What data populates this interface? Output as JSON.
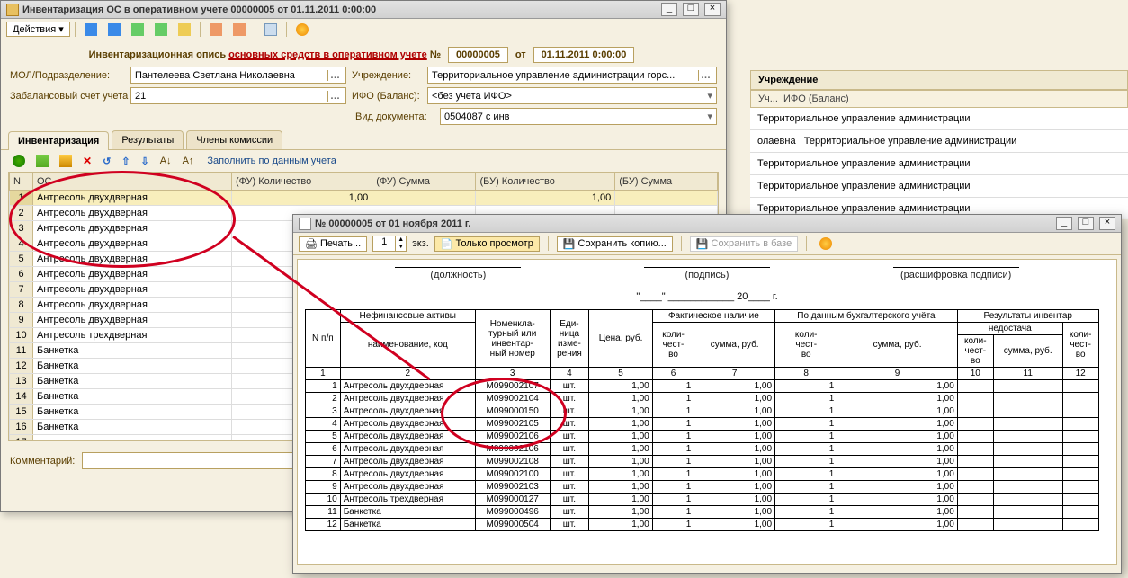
{
  "bg": {
    "hdr": "Учреждение",
    "sub_left": "Уч...",
    "sub_right": "ИФО (Баланс)",
    "row": "Территориальное управление администрации",
    "row2": "олаевна"
  },
  "win1": {
    "title": "Инвентаризация ОС в оперативном учете 00000005 от 01.11.2011 0:00:00",
    "actions": "Действия",
    "doc_title_a": "Инвентаризационная опись ",
    "doc_title_u": "основных средств в оперативном учете",
    "doc_title_b": " №",
    "number": "00000005",
    "ot": "от",
    "date": "01.11.2011 0:00:00",
    "l_mol": "МОЛ/Подразделение:",
    "v_mol": "Пантелеева Светлана Николаевна",
    "l_uch": "Учреждение:",
    "v_uch": "Территориальное управление администрации горс...",
    "l_zab": "Забалансовый счет учета ОС:",
    "v_zab": "21",
    "l_ifo": "ИФО (Баланс):",
    "v_ifo": "<без учета ИФО>",
    "l_vid": "Вид документа:",
    "v_vid": "0504087 с инв",
    "tabs": [
      "Инвентаризация",
      "Результаты",
      "Члены комиссии"
    ],
    "fill_link": "Заполнить по данным учета",
    "cols": [
      "N",
      "ОС",
      "(ФУ) Количество",
      "(ФУ) Сумма",
      "(БУ) Количество",
      "(БУ) Сумма"
    ],
    "rows": [
      {
        "n": 1,
        "os": "Антресоль двухдверная",
        "fuq": "1,00",
        "fus": "",
        "buq": "1,00",
        "bus": ""
      },
      {
        "n": 2,
        "os": "Антресоль двухдверная",
        "fuq": "",
        "fus": "",
        "buq": "",
        "bus": ""
      },
      {
        "n": 3,
        "os": "Антресоль двухдверная",
        "fuq": "",
        "fus": "",
        "buq": "",
        "bus": ""
      },
      {
        "n": 4,
        "os": "Антресоль двухдверная",
        "fuq": "",
        "fus": "",
        "buq": "",
        "bus": ""
      },
      {
        "n": 5,
        "os": "Антресоль двухдверная",
        "fuq": "",
        "fus": "",
        "buq": "",
        "bus": ""
      },
      {
        "n": 6,
        "os": "Антресоль двухдверная",
        "fuq": "",
        "fus": "",
        "buq": "",
        "bus": ""
      },
      {
        "n": 7,
        "os": "Антресоль двухдверная",
        "fuq": "",
        "fus": "",
        "buq": "",
        "bus": ""
      },
      {
        "n": 8,
        "os": "Антресоль двухдверная",
        "fuq": "",
        "fus": "",
        "buq": "",
        "bus": ""
      },
      {
        "n": 9,
        "os": "Антресоль двухдверная",
        "fuq": "",
        "fus": "",
        "buq": "",
        "bus": ""
      },
      {
        "n": 10,
        "os": "Антресоль трехдверная",
        "fuq": "",
        "fus": "",
        "buq": "",
        "bus": ""
      },
      {
        "n": 11,
        "os": "Банкетка",
        "fuq": "",
        "fus": "",
        "buq": "",
        "bus": ""
      },
      {
        "n": 12,
        "os": "Банкетка",
        "fuq": "",
        "fus": "",
        "buq": "",
        "bus": ""
      },
      {
        "n": 13,
        "os": "Банкетка",
        "fuq": "",
        "fus": "",
        "buq": "",
        "bus": ""
      },
      {
        "n": 14,
        "os": "Банкетка",
        "fuq": "",
        "fus": "",
        "buq": "",
        "bus": ""
      },
      {
        "n": 15,
        "os": "Банкетка",
        "fuq": "",
        "fus": "",
        "buq": "",
        "bus": ""
      },
      {
        "n": 16,
        "os": "Банкетка",
        "fuq": "",
        "fus": "",
        "buq": "",
        "bus": ""
      }
    ],
    "comment_lbl": "Комментарий:"
  },
  "win2": {
    "title": "№ 00000005 от 01 ноября 2011 г.",
    "print": "Печать...",
    "copies": "1",
    "ekz": "экз.",
    "view_only": "Только просмотр",
    "save_copy": "Сохранить копию...",
    "save_db": "Сохранить в базе",
    "sig1": "(должность)",
    "sig2": "(подпись)",
    "sig3": "(расшифровка подписи)",
    "date_pre": "\"",
    "date_mid": "\"",
    "date_y": " 20",
    "date_suf": " г.",
    "h_np": "N п/п",
    "h_nfa": "Нефинансовые активы",
    "h_name": "наименование, код",
    "h_nom": "Номенкла-\nтурный или\nинвентар-\nный номер",
    "h_ed": "Еди-\nница\nизме-\nрения",
    "h_price": "Цена, руб.",
    "h_fact": "Фактическое наличие",
    "h_acc": "По данным бухгалтерского учёта",
    "h_res": "Результаты инвентар",
    "h_short": "недостача",
    "h_qty": "коли-\nчест-\nво",
    "h_sum": "сумма, руб.",
    "colnums": [
      "1",
      "2",
      "3",
      "4",
      "5",
      "6",
      "7",
      "8",
      "9",
      "10",
      "11",
      "12"
    ],
    "rows": [
      {
        "n": 1,
        "name": "Антресоль двухдверная",
        "nom": "М099002107",
        "ed": "шт.",
        "price": "1,00",
        "fq": "1",
        "fs": "1,00",
        "aq": "1",
        "as": "1,00"
      },
      {
        "n": 2,
        "name": "Антресоль двухдверная",
        "nom": "М099002104",
        "ed": "шт.",
        "price": "1,00",
        "fq": "1",
        "fs": "1,00",
        "aq": "1",
        "as": "1,00"
      },
      {
        "n": 3,
        "name": "Антресоль двухдверная",
        "nom": "М099000150",
        "ed": "шт.",
        "price": "1,00",
        "fq": "1",
        "fs": "1,00",
        "aq": "1",
        "as": "1,00"
      },
      {
        "n": 4,
        "name": "Антресоль двухдверная",
        "nom": "М099002105",
        "ed": "шт.",
        "price": "1,00",
        "fq": "1",
        "fs": "1,00",
        "aq": "1",
        "as": "1,00"
      },
      {
        "n": 5,
        "name": "Антресоль двухдверная",
        "nom": "М099002106",
        "ed": "шт.",
        "price": "1,00",
        "fq": "1",
        "fs": "1,00",
        "aq": "1",
        "as": "1,00"
      },
      {
        "n": 6,
        "name": "Антресоль двухдверная",
        "nom": "М099002106",
        "ed": "шт.",
        "price": "1,00",
        "fq": "1",
        "fs": "1,00",
        "aq": "1",
        "as": "1,00"
      },
      {
        "n": 7,
        "name": "Антресоль двухдверная",
        "nom": "М099002108",
        "ed": "шт.",
        "price": "1,00",
        "fq": "1",
        "fs": "1,00",
        "aq": "1",
        "as": "1,00"
      },
      {
        "n": 8,
        "name": "Антресоль двухдверная",
        "nom": "М099002100",
        "ed": "шт.",
        "price": "1,00",
        "fq": "1",
        "fs": "1,00",
        "aq": "1",
        "as": "1,00"
      },
      {
        "n": 9,
        "name": "Антресоль двухдверная",
        "nom": "М099002103",
        "ed": "шт.",
        "price": "1,00",
        "fq": "1",
        "fs": "1,00",
        "aq": "1",
        "as": "1,00"
      },
      {
        "n": 10,
        "name": "Антресоль трехдверная",
        "nom": "М099000127",
        "ed": "шт.",
        "price": "1,00",
        "fq": "1",
        "fs": "1,00",
        "aq": "1",
        "as": "1,00"
      },
      {
        "n": 11,
        "name": "Банкетка",
        "nom": "М099000496",
        "ed": "шт.",
        "price": "1,00",
        "fq": "1",
        "fs": "1,00",
        "aq": "1",
        "as": "1,00"
      },
      {
        "n": 12,
        "name": "Банкетка",
        "nom": "М099000504",
        "ed": "шт.",
        "price": "1,00",
        "fq": "1",
        "fs": "1,00",
        "aq": "1",
        "as": "1,00"
      }
    ]
  }
}
